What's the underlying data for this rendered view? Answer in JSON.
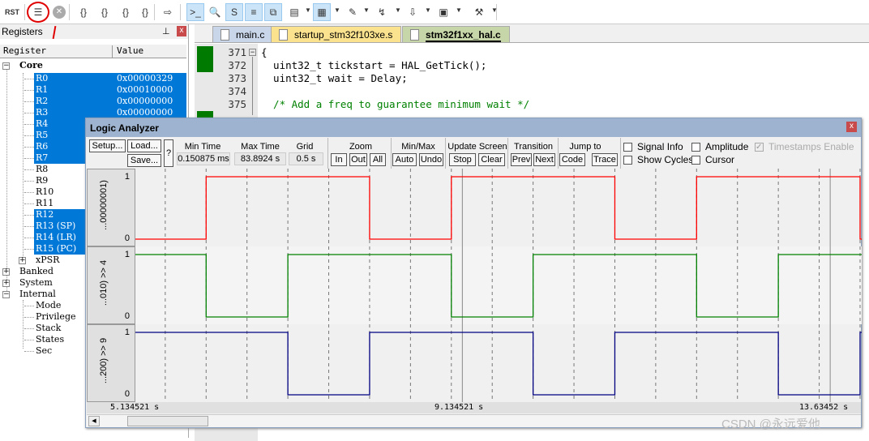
{
  "toolbar": {
    "items": [
      {
        "icon": "reset-icon",
        "label": "RST"
      },
      {
        "icon": "disassembly-step-icon"
      },
      {
        "icon": "stop-icon"
      },
      {
        "icon": "step-into-icon"
      },
      {
        "icon": "step-over-icon"
      },
      {
        "icon": "step-out-icon"
      },
      {
        "icon": "run-to-cursor-icon"
      },
      {
        "icon": "show-next-statement-icon"
      },
      {
        "icon": "command-window-icon"
      },
      {
        "icon": "disassembly-window-icon"
      },
      {
        "icon": "symbols-window-icon"
      },
      {
        "icon": "registers-window-icon"
      },
      {
        "icon": "call-stack-icon"
      },
      {
        "icon": "watch-window-icon"
      },
      {
        "icon": "memory-window-icon"
      },
      {
        "icon": "serial-window-icon"
      },
      {
        "icon": "analysis-window-icon"
      },
      {
        "icon": "trace-window-icon"
      },
      {
        "icon": "system-viewer-icon"
      },
      {
        "icon": "toolbox-icon"
      }
    ],
    "annotation_color": "#e00000"
  },
  "registers": {
    "title": "Registers",
    "col_register": "Register",
    "col_value": "Value",
    "groups": {
      "core": "Core",
      "banked": "Banked",
      "system": "System",
      "internal": "Internal",
      "xpsr": "xPSR"
    },
    "core": [
      {
        "name": "R0",
        "value": "0x00000329"
      },
      {
        "name": "R1",
        "value": "0x00010000"
      },
      {
        "name": "R2",
        "value": "0x00000000"
      },
      {
        "name": "R3",
        "value": "0x00000000"
      },
      {
        "name": "R4"
      },
      {
        "name": "R5"
      },
      {
        "name": "R6"
      },
      {
        "name": "R7"
      },
      {
        "name": "R8"
      },
      {
        "name": "R9"
      },
      {
        "name": "R10"
      },
      {
        "name": "R11"
      },
      {
        "name": "R12"
      },
      {
        "name": "R13 (SP)"
      },
      {
        "name": "R14 (LR)"
      },
      {
        "name": "R15 (PC)"
      }
    ],
    "internal": [
      "Mode",
      "Privilege",
      "Stack",
      "States",
      "Sec"
    ],
    "selection_color": "#0078d7"
  },
  "editor": {
    "tabs": [
      {
        "label": "main.c"
      },
      {
        "label": "startup_stm32f103xe.s"
      },
      {
        "label": "stm32f1xx_hal.c",
        "active": true
      }
    ],
    "lines": [
      {
        "num": "371",
        "text": "{"
      },
      {
        "num": "372",
        "text": "  uint32_t tickstart = HAL_GetTick();"
      },
      {
        "num": "373",
        "text": "  uint32_t wait = Delay;"
      },
      {
        "num": "374",
        "text": ""
      },
      {
        "num": "375",
        "text": "  /* Add a freq to guarantee minimum wait */",
        "comment": true
      }
    ]
  },
  "logic_analyzer": {
    "title": "Logic Analyzer",
    "setup": "Setup...",
    "load": "Load...",
    "save": "Save...",
    "help": "?",
    "min_time_label": "Min Time",
    "min_time": "0.150875 ms",
    "max_time_label": "Max Time",
    "max_time": "83.8924 s",
    "grid_label": "Grid",
    "grid": "0.5 s",
    "zoom_label": "Zoom",
    "zoom_in": "In",
    "zoom_out": "Out",
    "zoom_all": "All",
    "minmax_label": "Min/Max",
    "auto": "Auto",
    "undo": "Undo",
    "update_label": "Update Screen",
    "stop": "Stop",
    "clear": "Clear",
    "transition_label": "Transition",
    "prev": "Prev",
    "next": "Next",
    "jump_label": "Jump to",
    "code": "Code",
    "trace": "Trace",
    "signal_info": "Signal Info",
    "show_cycles": "Show Cycles",
    "amplitude": "Amplitude",
    "cursor": "Cursor",
    "timestamps": "Timestamps Enable",
    "checks": {
      "signal_info": false,
      "show_cycles": false,
      "amplitude": false,
      "cursor": false,
      "timestamps": true
    }
  },
  "chart_data": {
    "type": "line",
    "xlabel": "",
    "ylabel": "",
    "xlim": [
      5.134521,
      14.02
    ],
    "grid_interval": 0.5,
    "time_labels": [
      "5.134521 s",
      "9.134521 s",
      "13.63452 s"
    ],
    "cursors": [
      9.134521,
      13.63452
    ],
    "series": [
      {
        "name": "...00000001)",
        "color": "#ff0000",
        "ymin": "0",
        "ymax": "1",
        "steps": [
          [
            5.134521,
            0
          ],
          [
            6.0,
            1
          ],
          [
            8.0,
            0
          ],
          [
            9.0,
            1
          ],
          [
            11.0,
            0
          ],
          [
            12.0,
            1
          ],
          [
            14.0,
            0
          ]
        ]
      },
      {
        "name": "...010) >> 4",
        "color": "#008000",
        "ymin": "0",
        "ymax": "1",
        "steps": [
          [
            5.134521,
            1
          ],
          [
            6.0,
            0
          ],
          [
            7.0,
            1
          ],
          [
            9.0,
            0
          ],
          [
            10.0,
            1
          ],
          [
            12.0,
            0
          ],
          [
            13.0,
            1
          ]
        ]
      },
      {
        "name": "...200) >> 9",
        "color": "#000080",
        "ymin": "0",
        "ymax": "1",
        "steps": [
          [
            5.134521,
            1
          ],
          [
            7.0,
            0
          ],
          [
            8.0,
            1
          ],
          [
            10.0,
            0
          ],
          [
            11.0,
            1
          ],
          [
            13.0,
            0
          ],
          [
            14.0,
            1
          ]
        ]
      }
    ]
  },
  "watermark": "CSDN @永远爱他"
}
